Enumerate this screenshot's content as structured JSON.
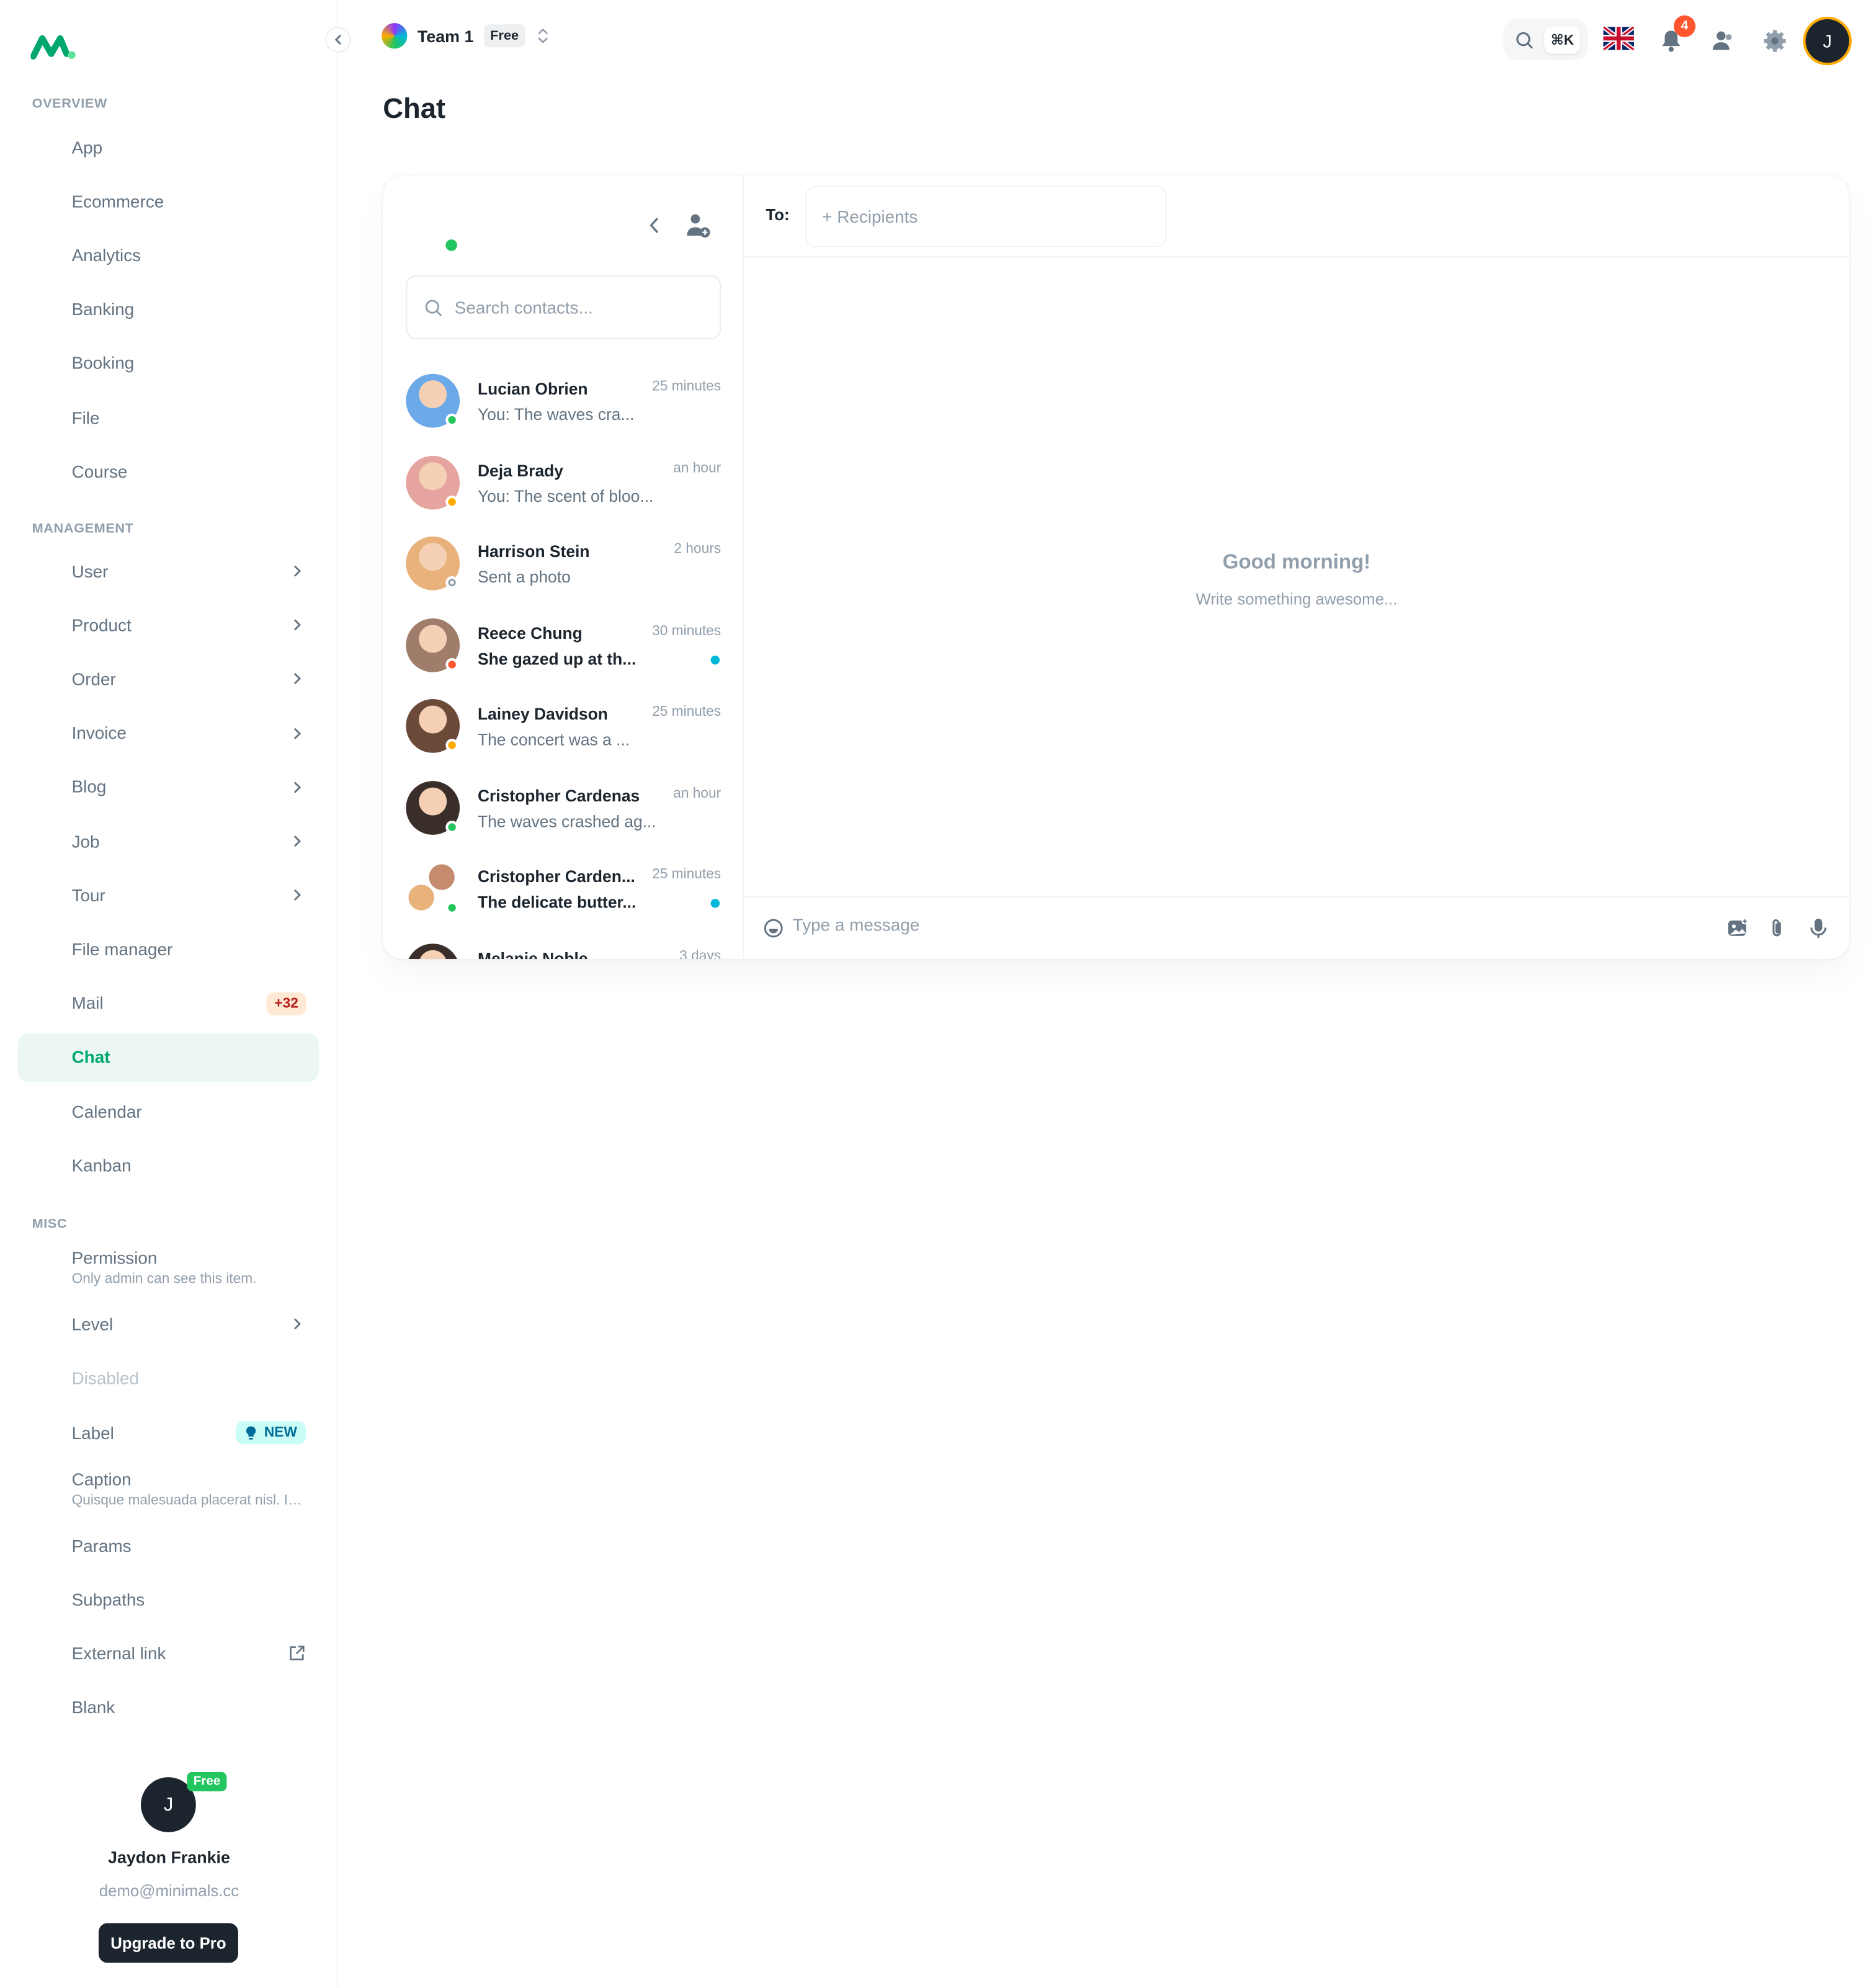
{
  "sidebar": {
    "sections": {
      "overview": "OVERVIEW",
      "management": "MANAGEMENT",
      "misc": "MISC"
    },
    "overview_items": [
      "App",
      "Ecommerce",
      "Analytics",
      "Banking",
      "Booking",
      "File",
      "Course"
    ],
    "management_items": [
      "User",
      "Product",
      "Order",
      "Invoice",
      "Blog",
      "Job",
      "Tour",
      "File manager",
      "Mail",
      "Chat",
      "Calendar",
      "Kanban"
    ],
    "mail_badge": "+32",
    "active_item": "Chat",
    "misc": {
      "permission": "Permission",
      "permission_caption": "Only admin can see this item.",
      "level": "Level",
      "disabled": "Disabled",
      "label": "Label",
      "label_badge": "NEW",
      "caption": "Caption",
      "caption_text": "Quisque malesuada placerat nisl. In...",
      "params": "Params",
      "subpaths": "Subpaths",
      "external": "External link",
      "blank": "Blank"
    },
    "user": {
      "initial": "J",
      "badge": "Free",
      "name": "Jaydon Frankie",
      "email": "demo@minimals.cc",
      "upgrade": "Upgrade to Pro"
    }
  },
  "header": {
    "workspace": "Team 1",
    "plan": "Free",
    "search_shortcut": "⌘K",
    "notifications": "4",
    "avatar_initial": "J"
  },
  "page": {
    "title": "Chat"
  },
  "chat": {
    "search_placeholder": "Search contacts...",
    "to_label": "To:",
    "recipients_placeholder": "+ Recipients",
    "empty_title": "Good morning!",
    "empty_subtitle": "Write something awesome...",
    "message_placeholder": "Type a message",
    "contacts": [
      {
        "name": "Lucian Obrien",
        "message": "You: The waves cra...",
        "time": "25 minutes",
        "status": "online",
        "unread": false,
        "color": "#6BA9E8"
      },
      {
        "name": "Deja Brady",
        "message": "You: The scent of bloo...",
        "time": "an hour",
        "status": "away",
        "unread": false,
        "color": "#E6A4A0"
      },
      {
        "name": "Harrison Stein",
        "message": "Sent a photo",
        "time": "2 hours",
        "status": "offline",
        "unread": false,
        "color": "#E8B27A"
      },
      {
        "name": "Reece Chung",
        "message": "She gazed up at th...",
        "time": "30 minutes",
        "status": "busy",
        "unread": true,
        "color": "#A07C6A"
      },
      {
        "name": "Lainey Davidson",
        "message": "The concert was a ...",
        "time": "25 minutes",
        "status": "away",
        "unread": false,
        "color": "#6B4A3A"
      },
      {
        "name": "Cristopher Cardenas",
        "message": "The waves crashed ag...",
        "time": "an hour",
        "status": "online",
        "unread": false,
        "color": "#3A2E2A"
      },
      {
        "name": "Cristopher Carden...",
        "message": "The delicate butter...",
        "time": "25 minutes",
        "status": "online",
        "unread": true,
        "group": true,
        "color": "#C58B6E"
      },
      {
        "name": "Melanie Noble",
        "message": "",
        "time": "3 days",
        "status": "",
        "unread": false,
        "color": "#3A2E2A"
      }
    ]
  },
  "colors": {
    "primary": "#00A76F",
    "online": "#22C55E",
    "away": "#FFAB00",
    "busy": "#FF5630",
    "offline": "#919EAB",
    "unread": "#00B8D9"
  }
}
